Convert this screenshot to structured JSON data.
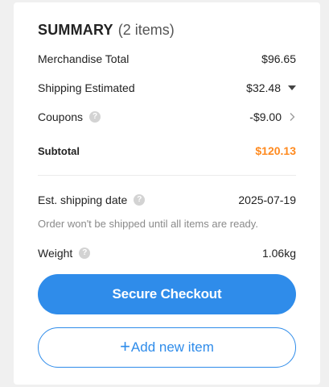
{
  "summary": {
    "title": "SUMMARY",
    "count": "(2 items)"
  },
  "merchandise": {
    "label": "Merchandise Total",
    "value": "$96.65"
  },
  "shipping": {
    "label": "Shipping Estimated",
    "value": "$32.48"
  },
  "coupons": {
    "label": "Coupons",
    "value": "-$9.00"
  },
  "subtotal": {
    "label": "Subtotal",
    "value": "$120.13",
    "color": "#ff8a1f"
  },
  "est_ship": {
    "label": "Est. shipping date",
    "value": "2025-07-19",
    "note": "Order won't be shipped until all items are ready."
  },
  "weight": {
    "label": "Weight",
    "value": "1.06kg"
  },
  "actions": {
    "checkout_label": "Secure Checkout",
    "add_plus": "+",
    "add_label": "Add new item",
    "accent": "#2f8cea"
  },
  "icons": {
    "help": "?"
  }
}
